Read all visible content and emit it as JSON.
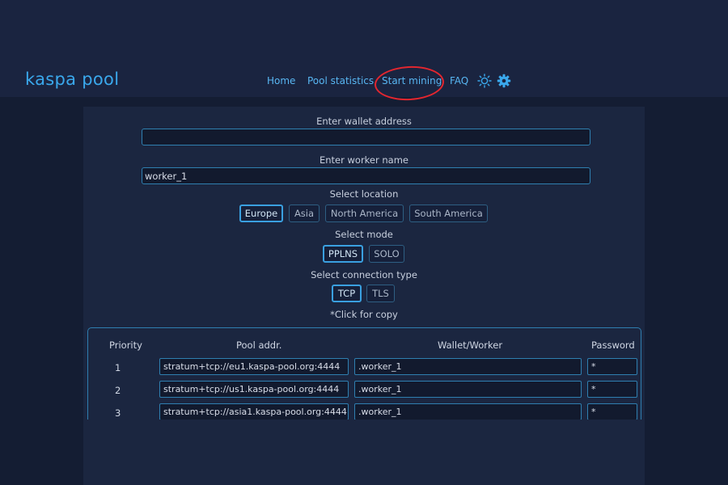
{
  "header": {
    "logo": "kaspa pool",
    "nav": [
      {
        "label": "Home"
      },
      {
        "label": "Pool statistics"
      },
      {
        "label": "Start mining"
      },
      {
        "label": "FAQ"
      }
    ]
  },
  "form": {
    "wallet_label": "Enter wallet address",
    "wallet_value": "",
    "worker_label": "Enter worker name",
    "worker_value": "worker_1",
    "location_label": "Select location",
    "locations": [
      "Europe",
      "Asia",
      "North America",
      "South America"
    ],
    "selected_location": "Europe",
    "mode_label": "Select mode",
    "modes": [
      "PPLNS",
      "SOLO"
    ],
    "selected_mode": "PPLNS",
    "conn_label": "Select connection type",
    "conns": [
      "TCP",
      "TLS"
    ],
    "selected_conn": "TCP",
    "copy_hint": "*Click for copy"
  },
  "table": {
    "headers": [
      "Priority",
      "Pool addr.",
      "Wallet/Worker",
      "Password"
    ],
    "rows": [
      {
        "priority": "1",
        "addr": "stratum+tcp://eu1.kaspa-pool.org:4444",
        "worker": ".worker_1",
        "password": "*"
      },
      {
        "priority": "2",
        "addr": "stratum+tcp://us1.kaspa-pool.org:4444",
        "worker": ".worker_1",
        "password": "*"
      },
      {
        "priority": "3",
        "addr": "stratum+tcp://asia1.kaspa-pool.org:4444",
        "worker": ".worker_1",
        "password": "*"
      }
    ]
  },
  "colors": {
    "accent": "#3aa8ec",
    "highlight_circle": "#e3262f"
  },
  "icons": [
    "sun-icon",
    "gear-icon"
  ]
}
